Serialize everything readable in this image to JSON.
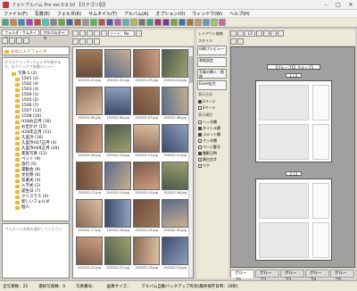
{
  "window": {
    "title": "フォトアルバム Pro ver.3.9.10 【カテゴリ別】"
  },
  "menu": [
    "ファイル(F)",
    "写真(E)",
    "フォルダ(R)",
    "サムネイル(T)",
    "アルバム(A)",
    "オプション(O)",
    "ウィンドウ(W)",
    "ヘルプ(H)"
  ],
  "left": {
    "tabs": [
      "フォルダ・サムネイル",
      "アルバムデータ"
    ],
    "favorites_label": "お気に入りフォルダ",
    "hint": "ダブルクリック→フォルダを開きます。右クリックで各種メニュー",
    "tree": [
      "写真-1 (2)",
      "1501 (2)",
      "1502 (4)",
      "1503 (3)",
      "1504 (1)",
      "1505 (2)",
      "1506 (7)",
      "1507 (13)",
      "1508 (10)",
      "H28お正月 (16)",
      "お出かけ (15)",
      "H28年正月 (11)",
      "久里浜 (16)",
      "久里浜H27正月 (4)",
      "久里浜H28正月 (20)",
      "家族写真 (12)",
      "ペット (9)",
      "旅行 (5)",
      "運動会 (8)",
      "文化祭 (6)",
      "卒業式 (3)",
      "入学式 (2)",
      "誕生日 (7)",
      "クリスマス (4)",
      "新しいフォルダ",
      "個人"
    ],
    "preview_hint": "サムネイル画像を選択してください"
  },
  "middle": {
    "sort_label": "ソート：No.",
    "thumbs": [
      "150102-01.jpg",
      "150102-02.jpg",
      "150102-03.jpg",
      "150102-04.jpg",
      "150102-05.jpg",
      "150102-06.jpg",
      "150102-07.jpg",
      "150102-08.jpg",
      "150102-09.jpg",
      "150102-10.jpg",
      "150102-11.jpg",
      "150102-12.jpg",
      "150102-13.jpg",
      "150102-14.jpg",
      "150102-15.jpg",
      "150102-16.jpg",
      "150102-17.jpg",
      "150102-18.jpg",
      "150102-19.jpg",
      "150102-20.jpg",
      "150102-21.jpg",
      "150102-22.jpg",
      "150102-23.jpg",
      "150102-24.jpg"
    ]
  },
  "right": {
    "tool_title": "レイアウト編集",
    "style_label": "スタイル",
    "buttons": [
      "印刷プレビュー",
      "表紙設定",
      "写真の挿入・削除",
      "Excel出力"
    ],
    "display_label": "表示方法",
    "display_opts": [
      "1ページ",
      "2ページ"
    ],
    "show_label": "表示項目",
    "show_opts": [
      "ヘッダ欄",
      "タイトル欄",
      "コメント欄",
      "フッタ欄",
      "ページ番号",
      "撮影日時",
      "黒白文字",
      "ワク"
    ],
    "page_label": "1/2",
    "group_title": "【グループ1】グループ1",
    "page_nums": [
      "1 / 2",
      "2 / 2"
    ],
    "bottom_tabs": [
      "グループ1",
      "グループ2",
      "グループ3",
      "グループ4",
      "グループ5"
    ]
  },
  "status": {
    "total": "全写真数：22",
    "selected": "選択写真数：0",
    "info": "写真番号：",
    "size": "画像サイズ：",
    "msg": "アルバム自動バックアップ有効(最終保存日時：10秒)"
  }
}
